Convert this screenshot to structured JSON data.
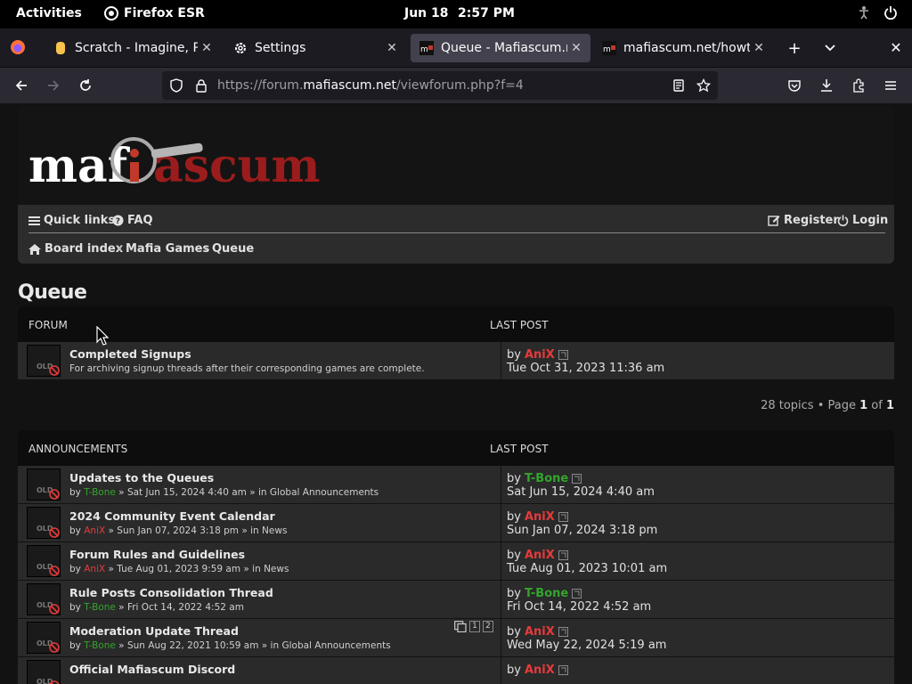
{
  "topbar": {
    "activities": "Activities",
    "app": "Firefox ESR",
    "date": "Jun 18",
    "time": "2:57 PM"
  },
  "tabs": [
    {
      "title": "Scratch - Imagine, Prog",
      "icon": "scratch-icon"
    },
    {
      "title": "Settings",
      "icon": "gear-icon"
    },
    {
      "title": "Queue - Mafiascum.net",
      "icon": "mafiascum-favicon",
      "active": true
    },
    {
      "title": "mafiascum.net/howto/",
      "icon": "mafiascum-favicon"
    }
  ],
  "url": {
    "prefix": "https://forum.",
    "domain": "mafiascum.net",
    "path": "/viewforum.php?f=4"
  },
  "site": {
    "logo_text": "mafiascum",
    "quicklinks": "Quick links",
    "faq": "FAQ",
    "register": "Register",
    "login": "Login",
    "breadcrumbs": [
      "Board index",
      "Mafia Games",
      "Queue"
    ]
  },
  "page_title": "Queue",
  "forum_table": {
    "col1": "FORUM",
    "col2": "LAST POST",
    "rows": [
      {
        "title": "Completed Signups",
        "desc": "For archiving signup threads after their corresponding games are complete.",
        "by_label": "by",
        "last_user": "AniX",
        "last_time": "Tue Oct 31, 2023 11:36 am"
      }
    ]
  },
  "pagination": {
    "text": "28 topics • Page ",
    "current": "1",
    "of": " of ",
    "total": "1"
  },
  "announcements": {
    "col1": "ANNOUNCEMENTS",
    "col2": "LAST POST",
    "rows": [
      {
        "title": "Updates to the Queues",
        "author": "T-Bone",
        "author_color": "green",
        "meta": " » Sat Jun 15, 2024 4:40 am » in Global Announcements",
        "last_user": "T-Bone",
        "last_color": "green",
        "last_time": "Sat Jun 15, 2024 4:40 am"
      },
      {
        "title": "2024 Community Event Calendar",
        "author": "AniX",
        "author_color": "red",
        "meta": " » Sun Jan 07, 2024 3:18 pm » in News",
        "last_user": "AniX",
        "last_color": "red",
        "last_time": "Sun Jan 07, 2024 3:18 pm"
      },
      {
        "title": "Forum Rules and Guidelines",
        "author": "AniX",
        "author_color": "red",
        "meta": " » Tue Aug 01, 2023 9:59 am » in News",
        "last_user": "AniX",
        "last_color": "red",
        "last_time": "Tue Aug 01, 2023 10:01 am"
      },
      {
        "title": "Rule Posts Consolidation Thread",
        "author": "T-Bone",
        "author_color": "green",
        "meta": " » Fri Oct 14, 2022 4:52 am",
        "last_user": "T-Bone",
        "last_color": "green",
        "last_time": "Fri Oct 14, 2022 4:52 am"
      },
      {
        "title": "Moderation Update Thread",
        "author": "T-Bone",
        "author_color": "green",
        "meta": " » Sun Aug 22, 2021 10:59 am » in Global Announcements",
        "last_user": "AniX",
        "last_color": "red",
        "last_time": "Wed May 22, 2024 5:19 am",
        "pages": [
          "1",
          "2"
        ]
      },
      {
        "title": "Official Mafiascum Discord",
        "author": "",
        "author_color": "red",
        "meta": "",
        "last_user": "AniX",
        "last_color": "red",
        "last_time": ""
      }
    ]
  },
  "by_label": "by",
  "old_label": "OLD"
}
